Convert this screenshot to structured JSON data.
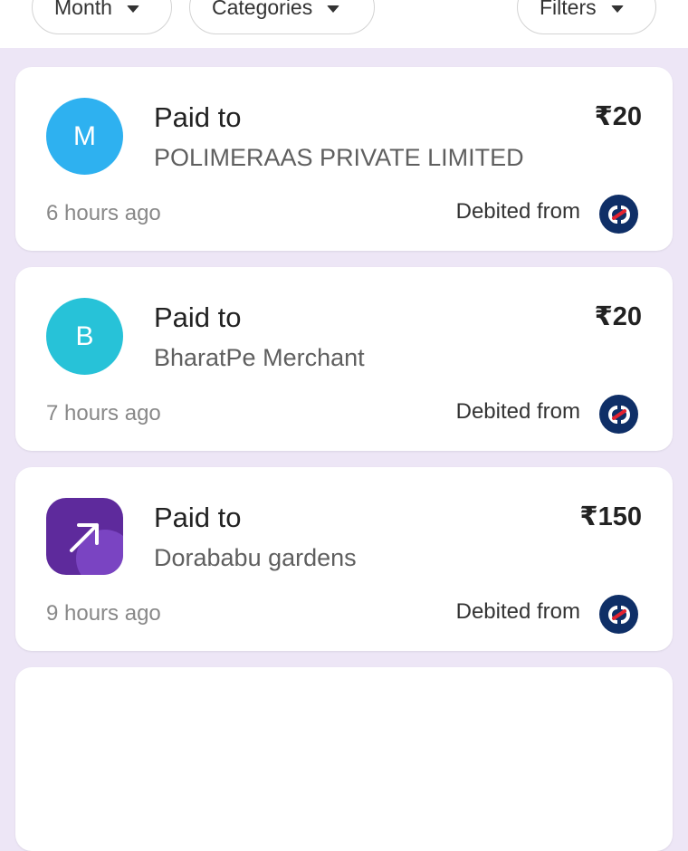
{
  "filters": {
    "month": "Month",
    "categories": "Categories",
    "filters": "Filters"
  },
  "transactions": [
    {
      "avatar_letter": "M",
      "avatar_color": "#2eb1f0",
      "title": "Paid to",
      "payee": "POLIMERAAS PRIVATE LIMITED",
      "amount": "₹20",
      "time": "6 hours ago",
      "debited_label": "Debited from",
      "bank_icon": "kotak-bank-icon"
    },
    {
      "avatar_letter": "B",
      "avatar_color": "#27c2d8",
      "title": "Paid to",
      "payee": "BharatPe Merchant",
      "amount": "₹20",
      "time": "7 hours ago",
      "debited_label": "Debited from",
      "bank_icon": "kotak-bank-icon"
    },
    {
      "avatar_icon": "arrow-up-right-icon",
      "avatar_color": "#5e2a9c",
      "title": "Paid to",
      "payee": "Dorababu gardens",
      "amount": "₹150",
      "time": "9 hours ago",
      "debited_label": "Debited from",
      "bank_icon": "kotak-bank-icon"
    }
  ],
  "colors": {
    "background": "#ede6f6",
    "card": "#ffffff",
    "bank_badge": "#0f2f67",
    "bank_accent": "#e4222f"
  }
}
